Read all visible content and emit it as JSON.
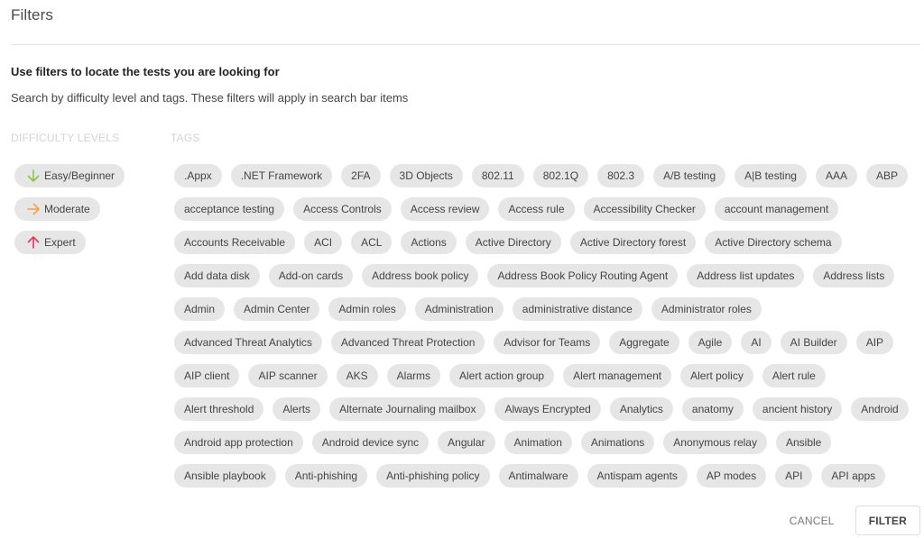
{
  "header": {
    "title": "Filters"
  },
  "intro": {
    "heading": "Use filters to locate the tests you are looking for",
    "description": "Search by difficulty level and tags. These filters will apply in search bar items"
  },
  "difficulty": {
    "label": "DIFFICULTY LEVELS",
    "items": [
      {
        "label": "Easy/Beginner",
        "icon": "arrow-down-icon",
        "color": "#8cc63f"
      },
      {
        "label": "Moderate",
        "icon": "arrow-right-icon",
        "color": "#f5a142"
      },
      {
        "label": "Expert",
        "icon": "arrow-up-icon",
        "color": "#e8355a"
      }
    ]
  },
  "tags": {
    "label": "TAGS",
    "items": [
      ".Appx",
      ".NET Framework",
      "2FA",
      "3D Objects",
      "802.11",
      "802.1Q",
      "802.3",
      "A/B testing",
      "A|B testing",
      "AAA",
      "ABP",
      "acceptance testing",
      "Access Controls",
      "Access review",
      "Access rule",
      "Accessibility Checker",
      "account management",
      "Accounts Receivable",
      "ACI",
      "ACL",
      "Actions",
      "Active Directory",
      "Active Directory forest",
      "Active Directory schema",
      "Add data disk",
      "Add-on cards",
      "Address book policy",
      "Address Book Policy Routing Agent",
      "Address list updates",
      "Address lists",
      "Admin",
      "Admin Center",
      "Admin roles",
      "Administration",
      "administrative distance",
      "Administrator roles",
      "Advanced Threat Analytics",
      "Advanced Threat Protection",
      "Advisor for Teams",
      "Aggregate",
      "Agile",
      "AI",
      "AI Builder",
      "AIP",
      "AIP client",
      "AIP scanner",
      "AKS",
      "Alarms",
      "Alert action group",
      "Alert management",
      "Alert policy",
      "Alert rule",
      "Alert threshold",
      "Alerts",
      "Alternate Journaling mailbox",
      "Always Encrypted",
      "Analytics",
      "anatomy",
      "ancient history",
      "Android",
      "Android app protection",
      "Android device sync",
      "Angular",
      "Animation",
      "Animations",
      "Anonymous relay",
      "Ansible",
      "Ansible playbook",
      "Anti-phishing",
      "Anti-phishing policy",
      "Antimalware",
      "Antispam agents",
      "AP modes",
      "API",
      "API apps"
    ]
  },
  "footer": {
    "cancel_label": "CANCEL",
    "filter_label": "FILTER"
  }
}
